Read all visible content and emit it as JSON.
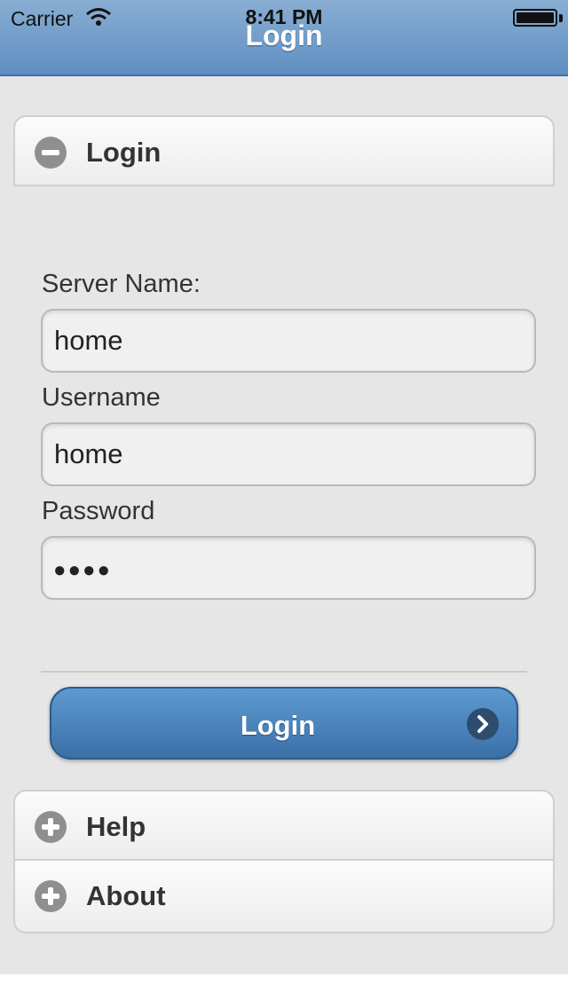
{
  "status_bar": {
    "carrier": "Carrier",
    "time": "8:41 PM"
  },
  "header": {
    "title": "Login"
  },
  "sections": {
    "login": {
      "label": "Login",
      "state": "expanded",
      "icon": "minus-icon"
    },
    "help": {
      "label": "Help",
      "state": "collapsed",
      "icon": "plus-icon"
    },
    "about": {
      "label": "About",
      "state": "collapsed",
      "icon": "plus-icon"
    }
  },
  "form": {
    "server_label": "Server Name:",
    "server_value": "home",
    "username_label": "Username",
    "username_value": "home",
    "password_label": "Password",
    "password_display": "●●●●",
    "submit_label": "Login"
  },
  "colors": {
    "header": "#6f9ccb",
    "button": "#4a84bd",
    "background": "#e6e6e6"
  }
}
